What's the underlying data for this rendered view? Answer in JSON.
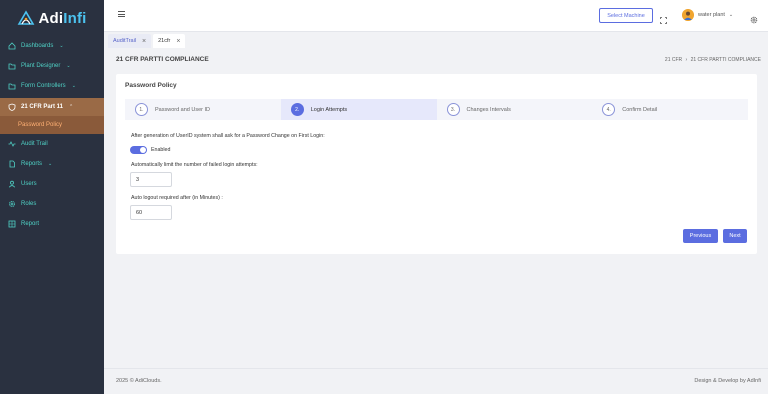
{
  "app": {
    "logo_prefix": "Adi",
    "logo_suffix": "Infi"
  },
  "sidebar": {
    "items": [
      {
        "label": "Dashboards",
        "icon": "home-icon",
        "chevron": true
      },
      {
        "label": "Plant Designer",
        "icon": "folder-icon",
        "chevron": true
      },
      {
        "label": "Form Controllers",
        "icon": "folder-icon",
        "chevron": true
      },
      {
        "label": "21 CFR Part 11",
        "icon": "shield-icon",
        "chevron": true,
        "expanded": true
      },
      {
        "label": "Password Policy",
        "icon": "lock-icon",
        "active": true
      },
      {
        "label": "Audit Trail",
        "icon": "activity-icon"
      },
      {
        "label": "Reports",
        "icon": "file-icon",
        "chevron": true
      },
      {
        "label": "Users",
        "icon": "user-icon"
      },
      {
        "label": "Roles",
        "icon": "gear-icon"
      },
      {
        "label": "Report",
        "icon": "grid-icon"
      }
    ]
  },
  "header": {
    "select_machine": "Select Machine",
    "user_name": "water plant"
  },
  "tabs": [
    {
      "label": "AuditTrail",
      "active": false
    },
    {
      "label": "21cfr",
      "active": true
    }
  ],
  "page": {
    "title": "21 CFR PARTTI COMPLIANCE",
    "breadcrumb_root": "21 CFR",
    "breadcrumb_sep": "›",
    "breadcrumb_current": "21 CFR PARTTI COMPLIANCE"
  },
  "card": {
    "title": "Password Policy",
    "steps": [
      {
        "num": "1.",
        "label": "Password and User ID",
        "active": false
      },
      {
        "num": "2.",
        "label": "Login Attempts",
        "active": true
      },
      {
        "num": "3.",
        "label": "Changes Intervals",
        "active": false
      },
      {
        "num": "4.",
        "label": "Confirm Detail",
        "active": false
      }
    ],
    "first_login_label": "After generation of UserID system shall ask for a Password Change on First Login:",
    "toggle_label": "Enabled",
    "toggle_on": true,
    "failed_attempts_label": "Automatically limit the number of failed login attempts:",
    "failed_attempts_value": "3",
    "auto_logout_label": "Auto logout required after (in Minutes) :",
    "auto_logout_value": "60",
    "previous_label": "Previous",
    "next_label": "Next"
  },
  "footer": {
    "copyright": "2025 © AdiClouds.",
    "credit": "Design & Develop by AdInfi"
  },
  "colors": {
    "sidebar_bg": "#2a3140",
    "sidebar_text": "#4fd1c5",
    "accent": "#5b6de0",
    "active_parent": "#9a6a46",
    "active_child_text": "#ffb074"
  }
}
